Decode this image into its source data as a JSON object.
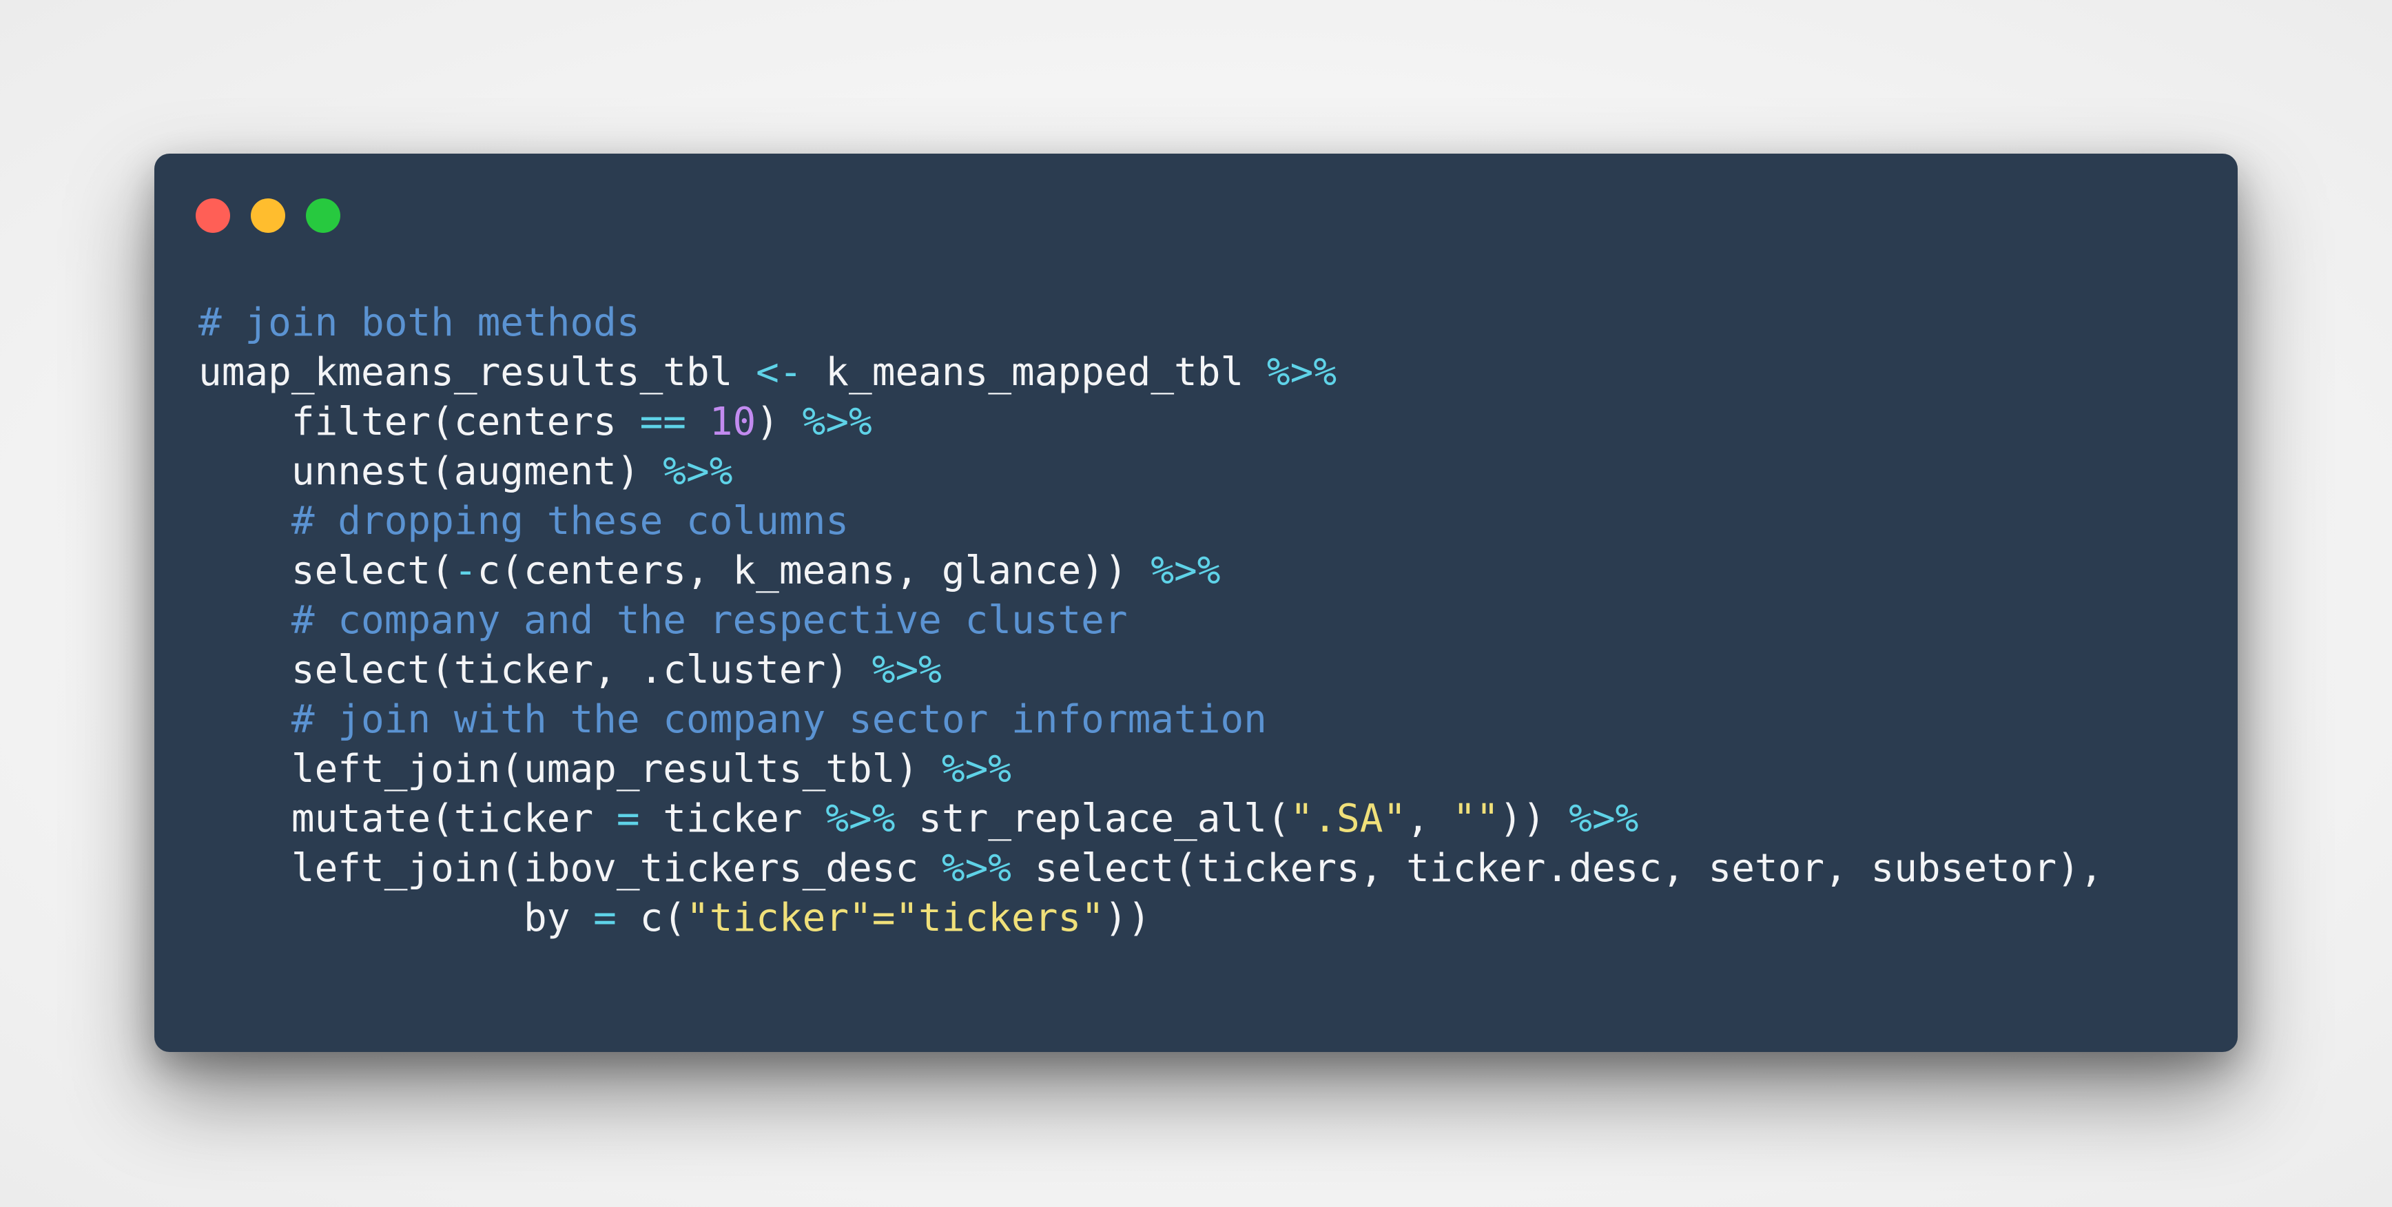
{
  "window": {
    "controls": [
      {
        "name": "close",
        "color": "#ff5f56"
      },
      {
        "name": "minimize",
        "color": "#ffbd2e"
      },
      {
        "name": "maximize",
        "color": "#27c93f"
      }
    ]
  },
  "colors": {
    "background": "#2b3c50",
    "comment": "#5b93d2",
    "operator": "#5fd3e8",
    "number": "#c28bf0",
    "string": "#f0e07a",
    "text": "#f3f4f6"
  },
  "code": {
    "lines": [
      [
        {
          "t": "c",
          "v": "# join both methods"
        }
      ],
      [
        {
          "t": "p",
          "v": "umap_kmeans_results_tbl "
        },
        {
          "t": "o",
          "v": "<-"
        },
        {
          "t": "p",
          "v": " k_means_mapped_tbl "
        },
        {
          "t": "o",
          "v": "%>%"
        }
      ],
      [
        {
          "t": "p",
          "v": "    filter(centers "
        },
        {
          "t": "o",
          "v": "=="
        },
        {
          "t": "p",
          "v": " "
        },
        {
          "t": "n",
          "v": "10"
        },
        {
          "t": "p",
          "v": ") "
        },
        {
          "t": "o",
          "v": "%>%"
        }
      ],
      [
        {
          "t": "p",
          "v": "    unnest(augment) "
        },
        {
          "t": "o",
          "v": "%>%"
        }
      ],
      [
        {
          "t": "c",
          "v": "    # dropping these columns"
        }
      ],
      [
        {
          "t": "p",
          "v": "    select("
        },
        {
          "t": "o",
          "v": "-"
        },
        {
          "t": "p",
          "v": "c(centers, k_means, glance)) "
        },
        {
          "t": "o",
          "v": "%>%"
        }
      ],
      [
        {
          "t": "c",
          "v": "    # company and the respective cluster"
        }
      ],
      [
        {
          "t": "p",
          "v": "    select(ticker, .cluster) "
        },
        {
          "t": "o",
          "v": "%>%"
        }
      ],
      [
        {
          "t": "c",
          "v": "    # join with the company sector information"
        }
      ],
      [
        {
          "t": "p",
          "v": "    left_join(umap_results_tbl) "
        },
        {
          "t": "o",
          "v": "%>%"
        }
      ],
      [
        {
          "t": "p",
          "v": "    mutate(ticker "
        },
        {
          "t": "o",
          "v": "="
        },
        {
          "t": "p",
          "v": " ticker "
        },
        {
          "t": "o",
          "v": "%>%"
        },
        {
          "t": "p",
          "v": " str_replace_all("
        },
        {
          "t": "s",
          "v": "\".SA\""
        },
        {
          "t": "p",
          "v": ", "
        },
        {
          "t": "s",
          "v": "\"\""
        },
        {
          "t": "p",
          "v": ")) "
        },
        {
          "t": "o",
          "v": "%>%"
        }
      ],
      [
        {
          "t": "p",
          "v": "    left_join(ibov_tickers_desc "
        },
        {
          "t": "o",
          "v": "%>%"
        },
        {
          "t": "p",
          "v": " select(tickers, ticker.desc, setor, subsetor),"
        }
      ],
      [
        {
          "t": "p",
          "v": "              by "
        },
        {
          "t": "o",
          "v": "="
        },
        {
          "t": "p",
          "v": " c("
        },
        {
          "t": "s",
          "v": "\"ticker\"=\"tickers\""
        },
        {
          "t": "p",
          "v": "))"
        }
      ]
    ]
  }
}
